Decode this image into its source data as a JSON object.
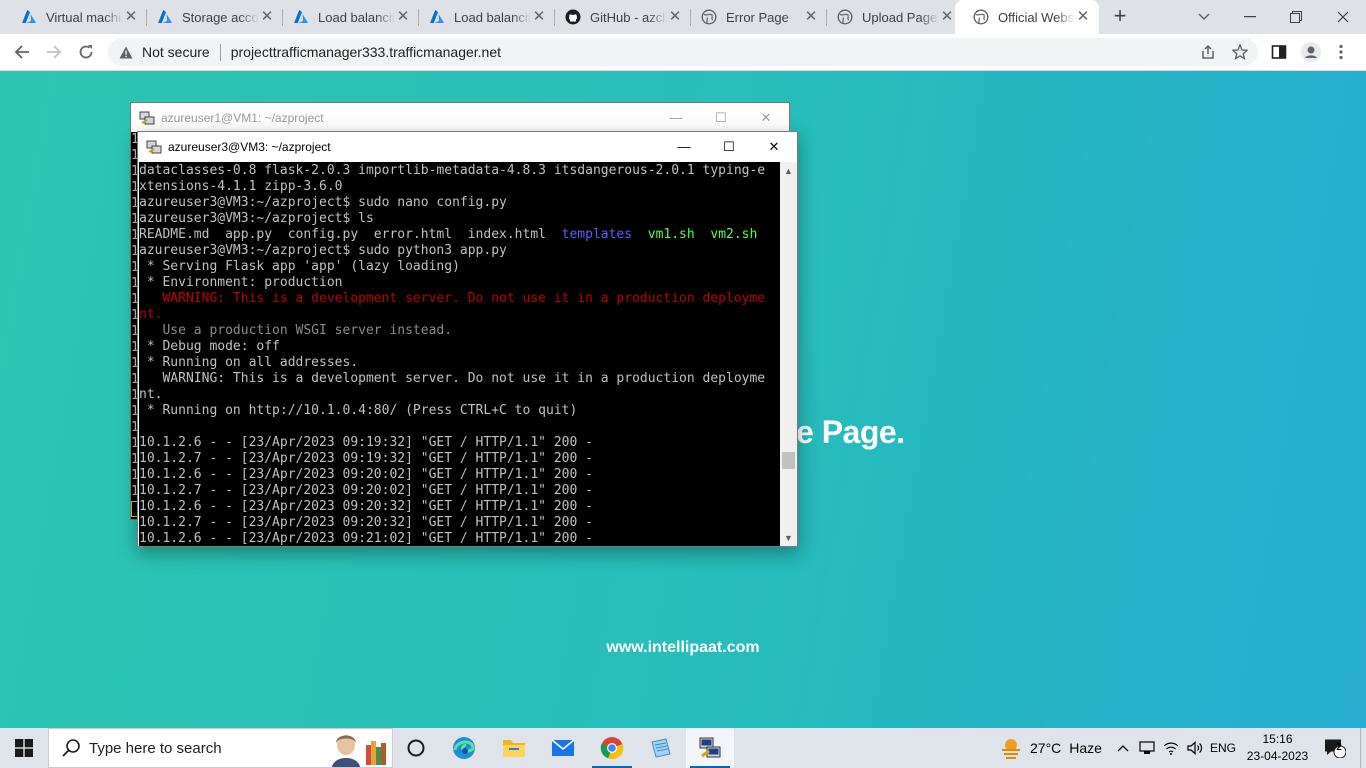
{
  "browser": {
    "tabs": [
      {
        "title": "Virtual machines",
        "icon": "azure-icon",
        "active": false
      },
      {
        "title": "Storage accounts",
        "icon": "azure-icon",
        "active": false
      },
      {
        "title": "Load balancing",
        "icon": "azure-icon",
        "active": false
      },
      {
        "title": "Load balancing",
        "icon": "azure-icon",
        "active": false
      },
      {
        "title": "GitHub - azcloud",
        "icon": "github-icon",
        "active": false
      },
      {
        "title": "Error Page",
        "icon": "globe-icon",
        "active": false
      },
      {
        "title": "Upload Page",
        "icon": "globe-icon",
        "active": false
      },
      {
        "title": "Official Website",
        "icon": "globe-icon",
        "active": true
      }
    ],
    "security_label": "Not secure",
    "url": "projecttrafficmanager333.trafficmanager.net"
  },
  "page": {
    "heading_fragment": "e Page.",
    "footer": "www.intellipaat.com",
    "gradient": [
      "#2cc6b0",
      "#25acd0"
    ]
  },
  "putty_vm1": {
    "title": "azureuser1@VM1: ~/azproject",
    "line_count": 23
  },
  "putty_vm3": {
    "title": "azureuser3@VM3: ~/azproject",
    "lines": [
      [
        {
          "t": "dataclasses-0.8 flask-2.0.3 importlib-metadata-4.8.3 itsdangerous-2.0.1 typing-e"
        }
      ],
      [
        {
          "t": "xtensions-4.1.1 zipp-3.6.0"
        }
      ],
      [
        {
          "t": "azureuser3@VM3:~/azproject$ sudo nano config.py"
        }
      ],
      [
        {
          "t": "azureuser3@VM3:~/azproject$ ls"
        }
      ],
      [
        {
          "t": "README.md  app.py  config.py  error.html  index.html  "
        },
        {
          "t": "templates",
          "c": "c-blue"
        },
        {
          "t": "  "
        },
        {
          "t": "vm1.sh",
          "c": "c-green"
        },
        {
          "t": "  "
        },
        {
          "t": "vm2.sh",
          "c": "c-green"
        }
      ],
      [
        {
          "t": "azureuser3@VM3:~/azproject$ sudo python3 app.py"
        }
      ],
      [
        {
          "t": " * Serving Flask app 'app' (lazy loading)"
        }
      ],
      [
        {
          "t": " * Environment: production"
        }
      ],
      [
        {
          "t": "   WARNING: This is a development server. Do not use it in a production deployme",
          "c": "c-warn"
        }
      ],
      [
        {
          "t": "nt.",
          "c": "c-warn"
        }
      ],
      [
        {
          "t": "   Use a production WSGI server instead.",
          "c": "c-dim"
        }
      ],
      [
        {
          "t": " * Debug mode: off"
        }
      ],
      [
        {
          "t": " * Running on all addresses."
        }
      ],
      [
        {
          "t": "   WARNING: This is a development server. Do not use it in a production deployme"
        }
      ],
      [
        {
          "t": "nt."
        }
      ],
      [
        {
          "t": " * Running on http://10.1.0.4:80/ (Press CTRL+C to quit)"
        }
      ],
      [
        {
          "t": ""
        }
      ],
      [
        {
          "t": "10.1.2.6 - - [23/Apr/2023 09:19:32] \"GET / HTTP/1.1\" 200 -"
        }
      ],
      [
        {
          "t": "10.1.2.7 - - [23/Apr/2023 09:19:32] \"GET / HTTP/1.1\" 200 -"
        }
      ],
      [
        {
          "t": "10.1.2.6 - - [23/Apr/2023 09:20:02] \"GET / HTTP/1.1\" 200 -"
        }
      ],
      [
        {
          "t": "10.1.2.7 - - [23/Apr/2023 09:20:02] \"GET / HTTP/1.1\" 200 -"
        }
      ],
      [
        {
          "t": "10.1.2.6 - - [23/Apr/2023 09:20:32] \"GET / HTTP/1.1\" 200 -"
        }
      ],
      [
        {
          "t": "10.1.2.7 - - [23/Apr/2023 09:20:32] \"GET / HTTP/1.1\" 200 -"
        }
      ],
      [
        {
          "t": "10.1.2.6 - - [23/Apr/2023 09:21:02] \"GET / HTTP/1.1\" 200 -"
        }
      ]
    ],
    "scroll_position": 0.82
  },
  "taskbar": {
    "search_placeholder": "Type here to search",
    "apps": [
      "task-view-icon",
      "edge-icon",
      "file-explorer-icon",
      "mail-icon",
      "chrome-icon",
      "notepad-icon",
      "putty-icon"
    ],
    "weather_temp": "27°C",
    "weather_desc": "Haze",
    "language": "ENG",
    "time": "15:16",
    "date": "23-04-2023",
    "notification_count": "2"
  }
}
